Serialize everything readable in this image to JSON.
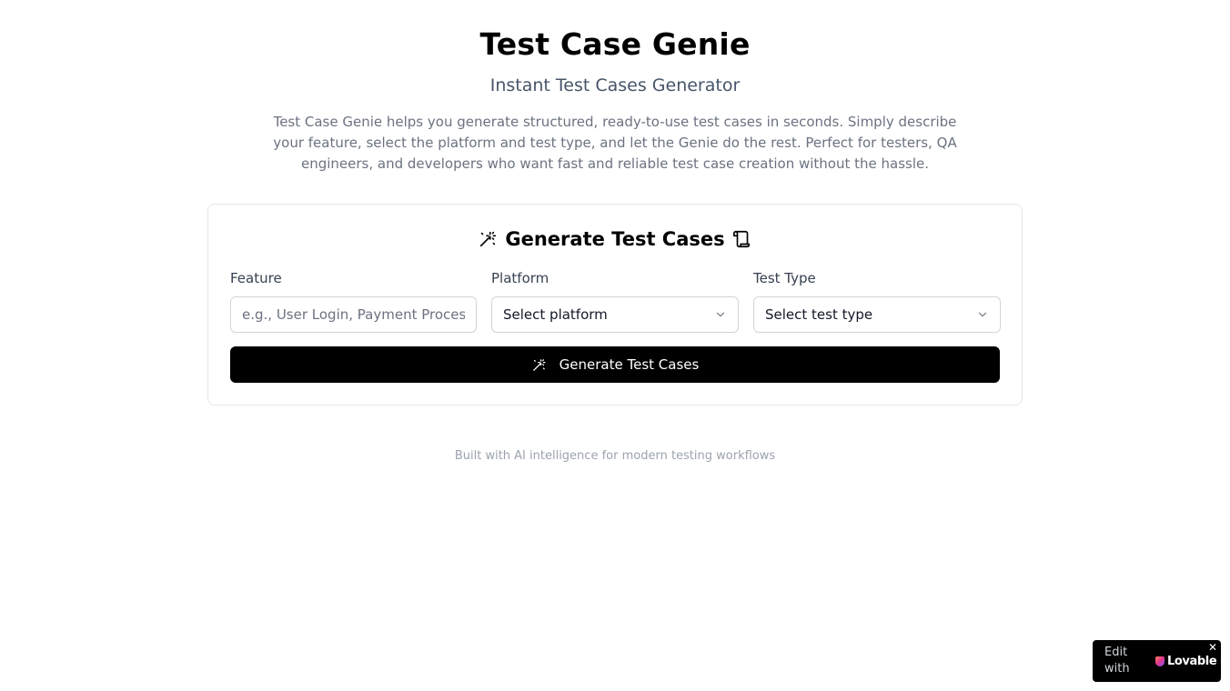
{
  "header": {
    "title": "Test Case Genie",
    "subtitle": "Instant Test Cases Generator",
    "description": "Test Case Genie helps you generate structured, ready-to-use test cases in seconds. Simply describe your feature, select the platform and test type, and let the Genie do the rest. Perfect for testers, QA engineers, and developers who want fast and reliable test case creation without the hassle."
  },
  "card": {
    "title": "Generate Test Cases",
    "title_icon_left": "magic-wand-icon",
    "title_icon_right": "scroll-icon",
    "feature": {
      "label": "Feature",
      "value": "",
      "placeholder": "e.g., User Login, Payment Processing"
    },
    "platform": {
      "label": "Platform",
      "selected": "Select platform",
      "icon": "chevron-down-icon"
    },
    "test_type": {
      "label": "Test Type",
      "selected": "Select test type",
      "icon": "chevron-down-icon"
    },
    "button": {
      "label": "Generate Test Cases",
      "icon": "magic-wand-icon"
    }
  },
  "footer": {
    "text": "Built with AI intelligence for modern testing workflows"
  },
  "badge": {
    "edit_label": "Edit with",
    "brand": "Lovable",
    "close": "✕"
  },
  "colors": {
    "primary_button": "#000000",
    "border": "#e5e7eb",
    "muted_text": "#6b7280",
    "footer_text": "#9ca3af"
  }
}
